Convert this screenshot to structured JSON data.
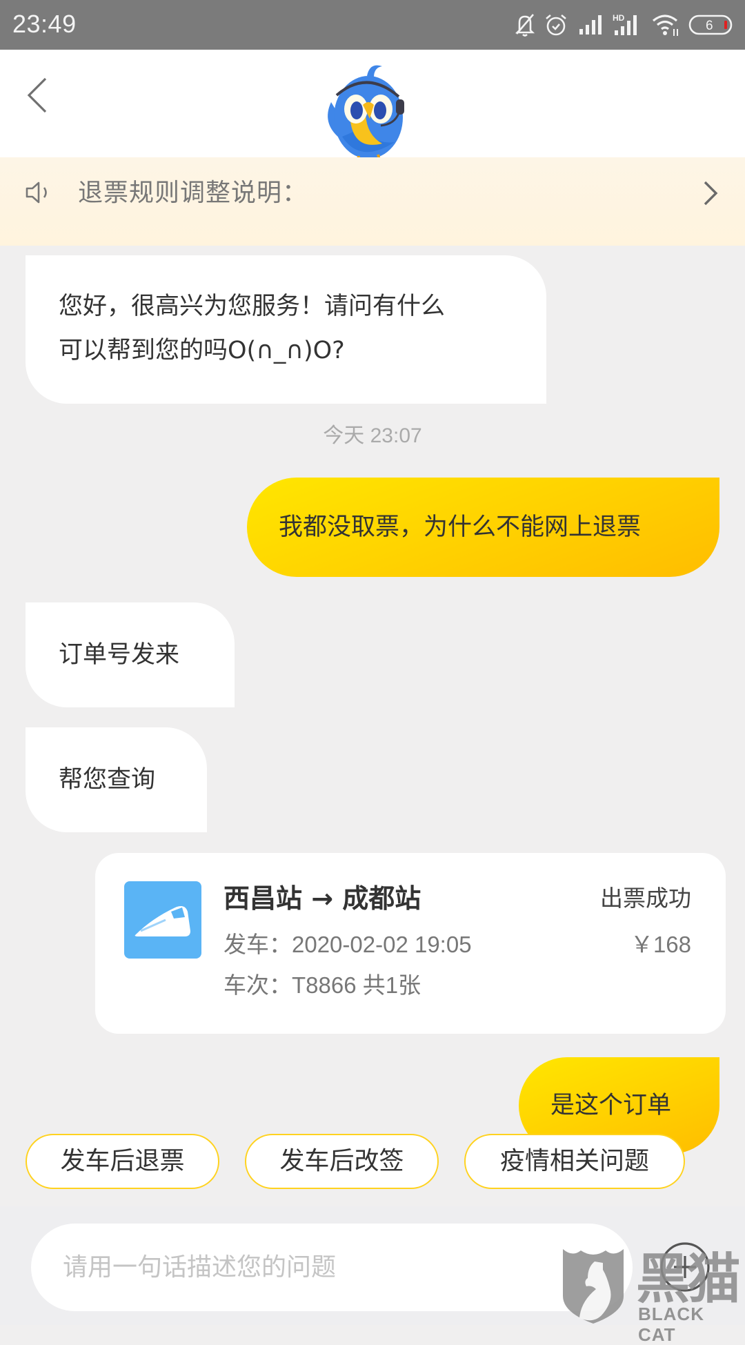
{
  "status_bar": {
    "time": "23:49",
    "icons": [
      "mute-bell-icon",
      "alarm-icon",
      "signal-icon",
      "hd-signal-icon",
      "wifi-icon",
      "battery-icon"
    ],
    "hd_label": "HD",
    "battery_level": "6",
    "battery_low_color": "#e02020"
  },
  "header": {
    "back_icon": "chevron-left-icon",
    "avatar": "customer-service-bird-mascot"
  },
  "notice": {
    "icon": "speaker-icon",
    "text": "退票规则调整说明：",
    "arrow_icon": "chevron-right-icon"
  },
  "chat": {
    "messages": [
      {
        "side": "agent",
        "lines": [
          "您好，很高兴为您服务！请问有什么",
          "可以帮到您的吗O(∩_∩)O?"
        ]
      },
      {
        "side": "timestamp",
        "text": "今天 23:07"
      },
      {
        "side": "user",
        "text": "我都没取票，为什么不能网上退票"
      },
      {
        "side": "agent",
        "text": "订单号发来"
      },
      {
        "side": "agent",
        "text": "帮您查询"
      },
      {
        "side": "user",
        "text": "是这个订单"
      }
    ],
    "order_card": {
      "icon": "train-icon",
      "route": "西昌站 → 成都站",
      "status": "出票成功",
      "departure": "发车：2020-02-02 19:05",
      "price": "￥168",
      "train_info": "车次：T8866 共1张"
    }
  },
  "quick_replies": [
    "发车后退票",
    "发车后改签",
    "疫情相关问题"
  ],
  "input_bar": {
    "placeholder": "请用一句话描述您的问题",
    "value": "",
    "plus_icon": "plus-circle-icon"
  },
  "watermark": {
    "cn": "黑猫",
    "en": "BLACK CAT"
  },
  "colors": {
    "accent_yellow": "#ffd200",
    "chip_border": "#ffd21e",
    "train_icon_bg": "#5ab4f5",
    "notice_bg": "#fff4de"
  }
}
